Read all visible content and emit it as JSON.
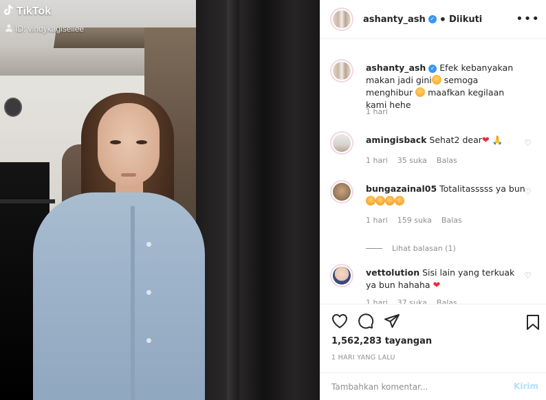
{
  "media": {
    "brand": "TikTok",
    "id_label": "ID: vindykagisellee"
  },
  "header": {
    "username": "ashanty_ash",
    "separator": "•",
    "follow_state": "Diikuti",
    "more_icon": "more-icon"
  },
  "caption": {
    "username": "ashanty_ash",
    "text_1": "Efek kebanyakan makan jadi gini",
    "text_2": " semoga menghibur ",
    "text_3": " maafkan kegilaan kami hehe",
    "time": "1 hari"
  },
  "comments": [
    {
      "username": "amingisback",
      "text": "Sehat2 dear",
      "time": "1 hari",
      "likes": "35 suka",
      "reply": "Balas"
    },
    {
      "username": "bungazainal05",
      "text": "Totalitasssss ya bun",
      "time": "1 hari",
      "likes": "159 suka",
      "reply": "Balas",
      "view_replies": "Lihat balasan (1)"
    },
    {
      "username": "vettolution",
      "text": "Sisi lain yang terkuak ya bun hahaha",
      "time": "1 hari",
      "likes": "37 suka",
      "reply": "Balas"
    }
  ],
  "stats": {
    "views": "1,562,283 tayangan",
    "posted": "1 HARI YANG LALU"
  },
  "comment_box": {
    "placeholder": "Tambahkan komentar...",
    "submit": "Kirim"
  },
  "colors": {
    "verified": "#3897f0",
    "heart_red": "#ed2c3a",
    "post_button_disabled": "#b2dffc"
  }
}
